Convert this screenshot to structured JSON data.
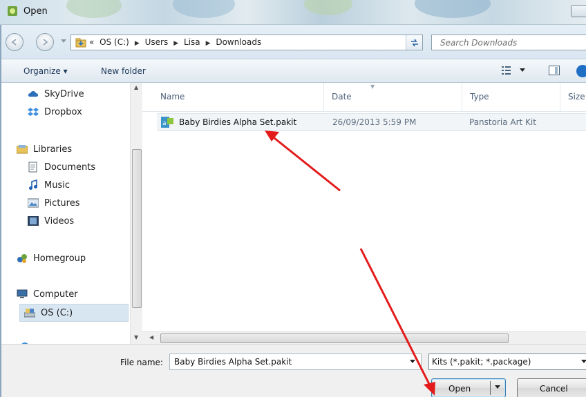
{
  "window": {
    "title": "Open"
  },
  "address": {
    "path": [
      "«",
      "OS (C:)",
      "Users",
      "Lisa",
      "Downloads"
    ],
    "search_placeholder": "Search Downloads"
  },
  "toolbar": {
    "organize": "Organize ▾",
    "new_folder": "New folder"
  },
  "nav": {
    "items": [
      {
        "label": "SkyDrive",
        "icon": "cloud-icon"
      },
      {
        "label": "Dropbox",
        "icon": "dropbox-icon"
      },
      {
        "label": "Libraries",
        "icon": "libraries-icon"
      },
      {
        "label": "Documents",
        "icon": "documents-icon"
      },
      {
        "label": "Music",
        "icon": "music-icon"
      },
      {
        "label": "Pictures",
        "icon": "pictures-icon"
      },
      {
        "label": "Videos",
        "icon": "videos-icon"
      },
      {
        "label": "Homegroup",
        "icon": "homegroup-icon"
      },
      {
        "label": "Computer",
        "icon": "computer-icon"
      },
      {
        "label": "OS (C:)",
        "icon": "drive-icon"
      }
    ]
  },
  "columns": {
    "name": "Name",
    "date": "Date",
    "type": "Type",
    "size": "Size"
  },
  "files": [
    {
      "name": "Baby Birdies Alpha Set.pakit",
      "date": "26/09/2013 5:59 PM",
      "type": "Panstoria Art Kit"
    }
  ],
  "bottom": {
    "file_name_label": "File name:",
    "file_name_value": "Baby Birdies Alpha Set.pakit",
    "filter": "Kits (*.pakit; *.package)",
    "open": "Open",
    "cancel": "Cancel"
  },
  "colors": {
    "arrow": "#e31b1b",
    "selection": "#d8e6f2",
    "link_text": "#1e395b"
  }
}
